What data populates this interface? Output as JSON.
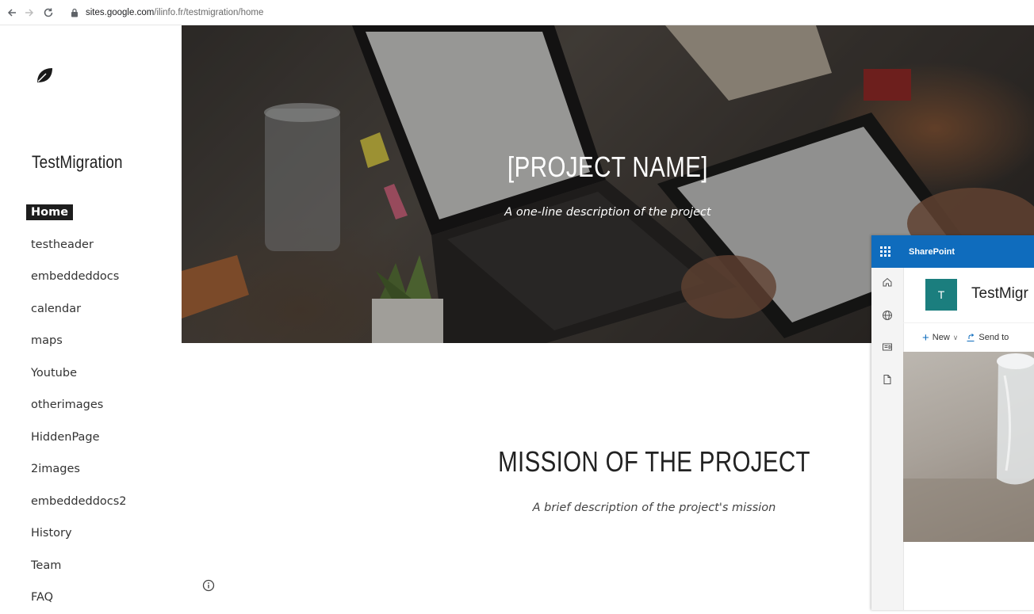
{
  "browser": {
    "url_host": "sites.google.com",
    "url_path": "/ilinfo.fr/testmigration/home"
  },
  "site": {
    "title": "TestMigration"
  },
  "nav": {
    "items": [
      {
        "label": "Home",
        "active": true
      },
      {
        "label": "testheader"
      },
      {
        "label": "embeddeddocs"
      },
      {
        "label": "calendar"
      },
      {
        "label": "maps"
      },
      {
        "label": "Youtube"
      },
      {
        "label": "otherimages"
      },
      {
        "label": "HiddenPage"
      },
      {
        "label": "2images"
      },
      {
        "label": "embeddeddocs2"
      },
      {
        "label": "History"
      },
      {
        "label": "Team"
      },
      {
        "label": "FAQ"
      }
    ]
  },
  "hero": {
    "title": "[PROJECT NAME]",
    "subtitle": "A one-line description of the project"
  },
  "mission": {
    "title": "MISSION OF THE PROJECT",
    "subtitle": "A brief description of the project's mission"
  },
  "sharepoint": {
    "brand": "SharePoint",
    "tile_letter": "T",
    "site_name": "TestMigr",
    "new_label": "New",
    "send_label": "Send to",
    "accent_color": "#0f6cbd",
    "tile_color": "#1b7e7e"
  },
  "icons": {
    "back": "back-arrow-icon",
    "forward": "forward-arrow-icon",
    "reload": "reload-icon",
    "lock": "lock-icon",
    "logo": "leaf-icon",
    "info": "info-icon",
    "waffle": "app-launcher-icon"
  }
}
